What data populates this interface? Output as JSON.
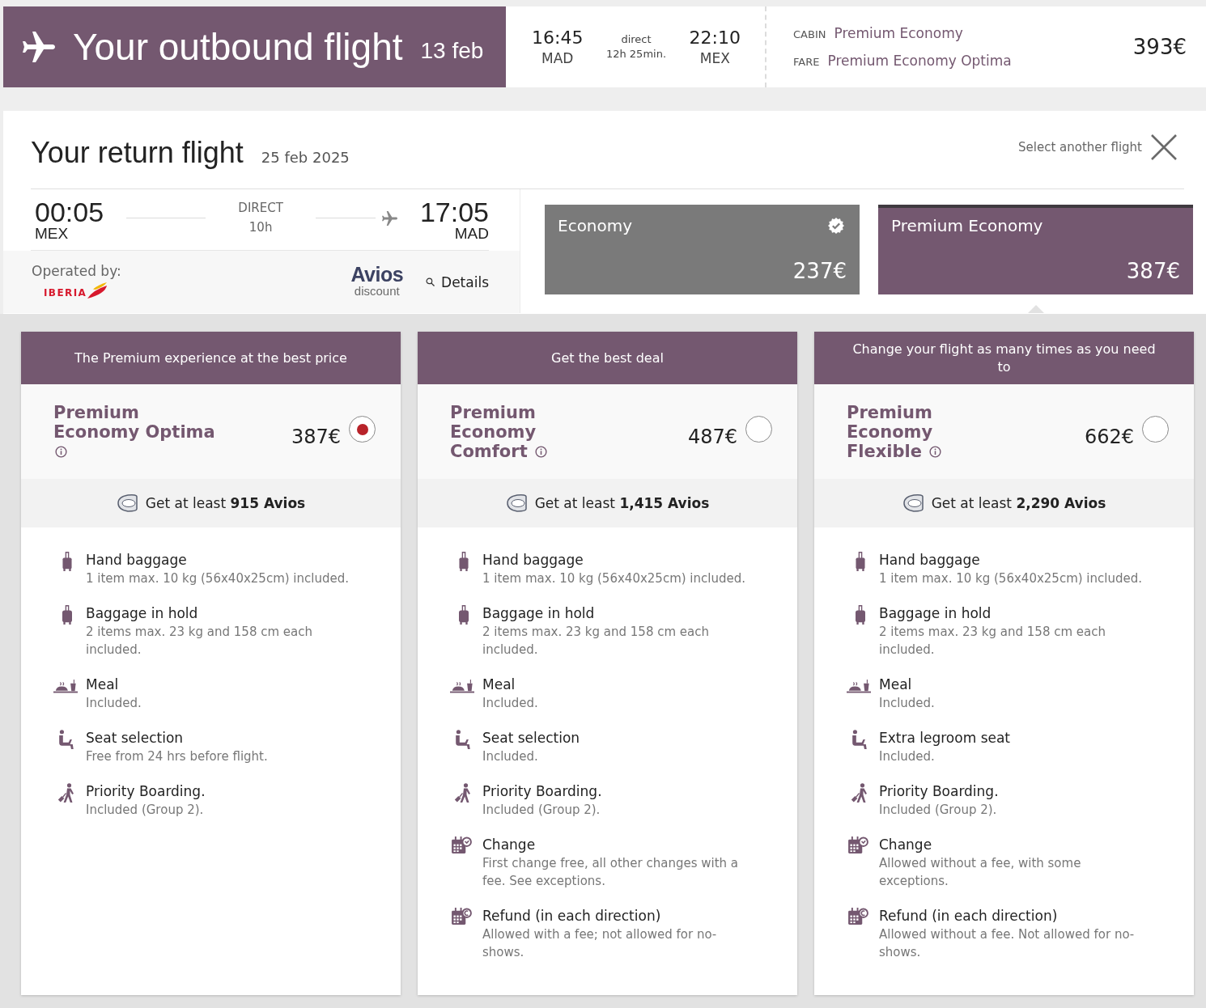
{
  "outbound": {
    "title": "Your outbound flight",
    "date": "13 feb",
    "departure": {
      "time": "16:45",
      "airport": "MAD"
    },
    "route": {
      "label": "direct",
      "duration": "12h 25min."
    },
    "arrival": {
      "time": "22:10",
      "airport": "MEX"
    },
    "cabin_label": "CABIN",
    "cabin": "Premium Economy",
    "fare_label": "FARE",
    "fare": "Premium Economy Optima",
    "price": "393€"
  },
  "return": {
    "title": "Your return flight",
    "date": "25 feb 2025",
    "select_another": "Select another flight",
    "departure": {
      "time": "00:05",
      "airport": "MEX"
    },
    "route": {
      "label": "DIRECT",
      "duration": "10h"
    },
    "arrival": {
      "time": "17:05",
      "airport": "MAD"
    },
    "operated_by": "Operated by:",
    "operator": "IBERIA",
    "avios_logo": {
      "line_1": "Avios",
      "line_2": "discount"
    },
    "details": "Details"
  },
  "cabins": [
    {
      "label": "Economy",
      "price": "237€",
      "selected": false,
      "badge": true
    },
    {
      "label": "Premium Economy",
      "price": "387€",
      "selected": true,
      "badge": false
    }
  ],
  "fares": [
    {
      "header": "The Premium experience at the best price",
      "name": "Premium Economy Optima",
      "price": "387€",
      "selected": true,
      "avios": "Get at least **915 Avios**",
      "features": [
        {
          "kind": "hand-baggage",
          "title": "Hand baggage",
          "detail": "1 item max. 10 kg (56x40x25cm) included."
        },
        {
          "kind": "hold-baggage",
          "title": "Baggage in hold",
          "detail": "2 items max. 23 kg and 158 cm each included."
        },
        {
          "kind": "meal",
          "title": "Meal",
          "detail": "Included."
        },
        {
          "kind": "seat",
          "title": "Seat selection",
          "detail": "Free from 24 hrs before flight."
        },
        {
          "kind": "boarding",
          "title": "Priority Boarding.",
          "detail": "Included (Group 2)."
        }
      ]
    },
    {
      "header": "Get the best deal",
      "name": "Premium Economy Comfort",
      "price": "487€",
      "selected": false,
      "avios": "Get at least **1,415 Avios**",
      "features": [
        {
          "kind": "hand-baggage",
          "title": "Hand baggage",
          "detail": "1 item max. 10 kg (56x40x25cm) included."
        },
        {
          "kind": "hold-baggage",
          "title": "Baggage in hold",
          "detail": "2 items max. 23 kg and 158 cm each included."
        },
        {
          "kind": "meal",
          "title": "Meal",
          "detail": "Included."
        },
        {
          "kind": "seat",
          "title": "Seat selection",
          "detail": "Included."
        },
        {
          "kind": "boarding",
          "title": "Priority Boarding.",
          "detail": "Included (Group 2)."
        },
        {
          "kind": "change",
          "title": "Change",
          "detail": "First change free, all other changes with a fee. See exceptions."
        },
        {
          "kind": "refund",
          "title": "Refund (in each direction)",
          "detail": "Allowed with a fee; not allowed for no-shows."
        }
      ]
    },
    {
      "header": "Change your flight as many times as you need to",
      "name": "Premium Economy Flexible",
      "price": "662€",
      "selected": false,
      "avios": "Get at least **2,290 Avios**",
      "features": [
        {
          "kind": "hand-baggage",
          "title": "Hand baggage",
          "detail": "1 item max. 10 kg (56x40x25cm) included."
        },
        {
          "kind": "hold-baggage",
          "title": "Baggage in hold",
          "detail": "2 items max. 23 kg and 158 cm each included."
        },
        {
          "kind": "meal",
          "title": "Meal",
          "detail": "Included."
        },
        {
          "kind": "seat",
          "title": "Extra legroom seat",
          "detail": "Included."
        },
        {
          "kind": "boarding",
          "title": "Priority Boarding.",
          "detail": "Included (Group 2)."
        },
        {
          "kind": "change",
          "title": "Change",
          "detail": "Allowed without a fee, with some exceptions."
        },
        {
          "kind": "refund",
          "title": "Refund (in each direction)",
          "detail": "Allowed without a fee. Not allowed for no-shows."
        }
      ]
    }
  ]
}
